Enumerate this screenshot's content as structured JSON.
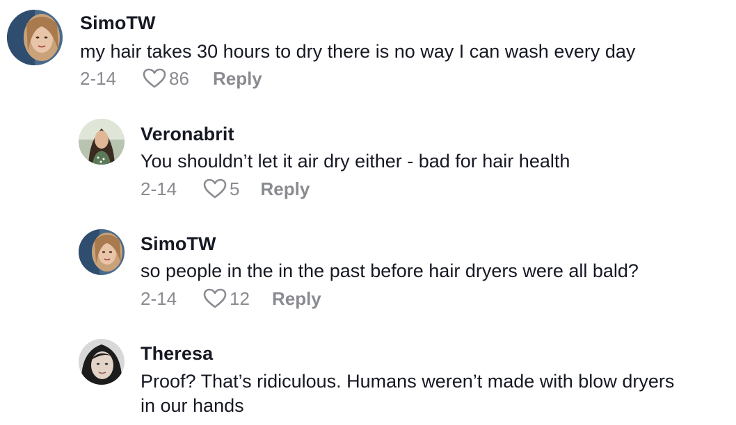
{
  "comments": [
    {
      "username": "SimoTW",
      "text": "my hair takes 30 hours to dry there is no way I can wash every day",
      "date": "2-14",
      "likes": "86",
      "reply_label": "Reply"
    },
    {
      "username": "Veronabrit",
      "text": "You shouldn’t let it air dry either - bad for hair health",
      "date": "2-14",
      "likes": "5",
      "reply_label": "Reply"
    },
    {
      "username": "SimoTW",
      "text": "so people in the in the past before hair dryers were all bald?",
      "date": "2-14",
      "likes": "12",
      "reply_label": "Reply"
    },
    {
      "username": "Theresa",
      "text_line1": "Proof? That’s ridiculous. Humans weren’t made with blow dryers",
      "text_line2": "in our hands"
    }
  ],
  "icons": {
    "like": "heart-outline-icon"
  },
  "colors": {
    "text": "#161823",
    "secondary": "#8a8b91"
  }
}
